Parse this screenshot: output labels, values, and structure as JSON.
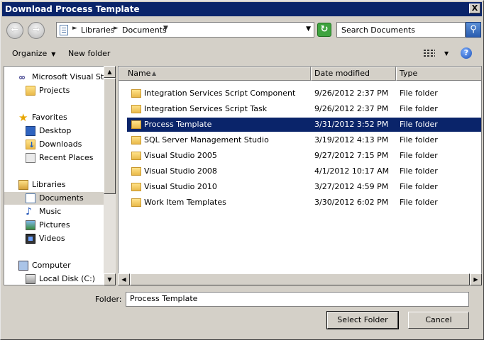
{
  "window": {
    "title": "Download Process Template",
    "close_glyph": "X"
  },
  "address": {
    "crumbs": [
      "Libraries",
      "Documents"
    ],
    "search_placeholder": "Search Documents"
  },
  "toolbar": {
    "organize_label": "Organize",
    "new_folder_label": "New folder"
  },
  "nav_pane": {
    "items": [
      {
        "label": "Microsoft Visual Studi",
        "icon": "visual-studio-icon"
      },
      {
        "label": "Projects",
        "icon": "folder-icon"
      },
      {
        "label": "Favorites",
        "icon": "star-icon"
      },
      {
        "label": "Desktop",
        "icon": "desktop-icon"
      },
      {
        "label": "Downloads",
        "icon": "downloads-icon"
      },
      {
        "label": "Recent Places",
        "icon": "recent-places-icon"
      },
      {
        "label": "Libraries",
        "icon": "library-icon"
      },
      {
        "label": "Documents",
        "icon": "documents-icon",
        "selected": true
      },
      {
        "label": "Music",
        "icon": "music-icon"
      },
      {
        "label": "Pictures",
        "icon": "pictures-icon"
      },
      {
        "label": "Videos",
        "icon": "videos-icon"
      },
      {
        "label": "Computer",
        "icon": "computer-icon"
      },
      {
        "label": "Local Disk (C:)",
        "icon": "disk-icon"
      }
    ]
  },
  "file_list": {
    "columns": {
      "name": "Name",
      "date": "Date modified",
      "type": "Type"
    },
    "rows": [
      {
        "name": "Integration Services Script Component",
        "date": "9/26/2012 2:37 PM",
        "type": "File folder"
      },
      {
        "name": "Integration Services Script Task",
        "date": "9/26/2012 2:37 PM",
        "type": "File folder"
      },
      {
        "name": "Process Template",
        "date": "3/31/2012 3:52 PM",
        "type": "File folder",
        "selected": true
      },
      {
        "name": "SQL Server Management Studio",
        "date": "3/19/2012 4:13 PM",
        "type": "File folder"
      },
      {
        "name": "Visual Studio 2005",
        "date": "9/27/2012 7:15 PM",
        "type": "File folder"
      },
      {
        "name": "Visual Studio 2008",
        "date": "4/1/2012 10:17 AM",
        "type": "File folder"
      },
      {
        "name": "Visual Studio 2010",
        "date": "3/27/2012 4:59 PM",
        "type": "File folder"
      },
      {
        "name": "Work Item Templates",
        "date": "3/30/2012 6:02 PM",
        "type": "File folder"
      }
    ]
  },
  "footer": {
    "folder_label": "Folder:",
    "folder_value": "Process Template",
    "select_label": "Select Folder",
    "cancel_label": "Cancel"
  },
  "colors": {
    "title_bar": "#0a246a",
    "selection": "#0a246a",
    "chrome": "#d4d0c8"
  }
}
